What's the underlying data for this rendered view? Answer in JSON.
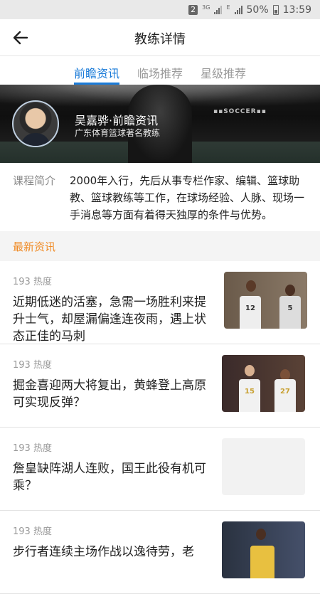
{
  "status_bar": {
    "sim_badge": "2",
    "network_3g": "3G",
    "network_e": "E",
    "battery": "50%",
    "time": "13:59"
  },
  "header": {
    "title": "教练详情"
  },
  "tabs": [
    {
      "label": "前瞻资讯",
      "active": true
    },
    {
      "label": "临场推荐",
      "active": false
    },
    {
      "label": "星级推荐",
      "active": false
    }
  ],
  "coach": {
    "name_line": "吴嘉骅·前瞻资讯",
    "description": "广东体育篮球著名教练"
  },
  "intro": {
    "label": "课程简介",
    "text": "2000年入行，先后从事专栏作家、编辑、篮球助教、篮球教练等工作，在球场经验、人脉、现场一手消息等方面有着得天独厚的条件与优势。"
  },
  "latest": {
    "heading": "最新资讯"
  },
  "news": [
    {
      "heat": "193 热度",
      "headline": "近期低迷的活塞，急需一场胜利来提升士气，却屋漏偏逢连夜雨，遇上状态正佳的马刺",
      "thumb": "spurs",
      "jerseys": [
        "12",
        "5"
      ]
    },
    {
      "heat": "193 热度",
      "headline": "掘金喜迎两大将复出，黄蜂登上高原可实现反弹？",
      "thumb": "nuggets",
      "jerseys": [
        "15",
        "27"
      ]
    },
    {
      "heat": "193 热度",
      "headline": "詹皇缺阵湖人连败，国王此役有机可乘？",
      "thumb": "empty",
      "jerseys": []
    },
    {
      "heat": "193 热度",
      "headline": "步行者连续主场作战以逸待劳，老",
      "thumb": "pacers",
      "jerseys": []
    }
  ],
  "colors": {
    "accent": "#1a7bd8",
    "section_orange": "#f08a24"
  }
}
